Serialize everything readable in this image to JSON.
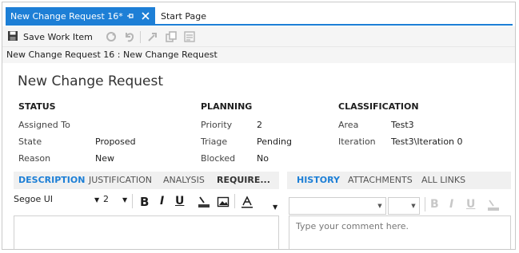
{
  "tabs": {
    "active_label": "New Change Request 16*",
    "inactive_label": "Start Page"
  },
  "toolbar": {
    "save_label": "Save Work Item"
  },
  "breadcrumb": "New Change Request 16 : New Change Request",
  "form": {
    "title": "New Change Request",
    "status": {
      "heading": "STATUS",
      "fields": [
        {
          "label": "Assigned To",
          "value": ""
        },
        {
          "label": "State",
          "value": "Proposed"
        },
        {
          "label": "Reason",
          "value": "New"
        }
      ]
    },
    "planning": {
      "heading": "PLANNING",
      "fields": [
        {
          "label": "Priority",
          "value": "2"
        },
        {
          "label": "Triage",
          "value": "Pending"
        },
        {
          "label": "Blocked",
          "value": "No"
        }
      ]
    },
    "classification": {
      "heading": "CLASSIFICATION",
      "fields": [
        {
          "label": "Area",
          "value": "Test3"
        },
        {
          "label": "Iteration",
          "value": "Test3\\Iteration 0"
        }
      ]
    }
  },
  "left_tabs": [
    "DESCRIPTION",
    "JUSTIFICATION",
    "ANALYSIS",
    "REQUIRE..."
  ],
  "right_tabs": [
    "HISTORY",
    "ATTACHMENTS",
    "ALL LINKS"
  ],
  "rich_text": {
    "font": "Segoe UI",
    "size": "2"
  },
  "comment_placeholder": "Type your comment here.",
  "colors": {
    "accent": "#1d7fd6",
    "toolbar_bg": "#f5f5f5"
  }
}
